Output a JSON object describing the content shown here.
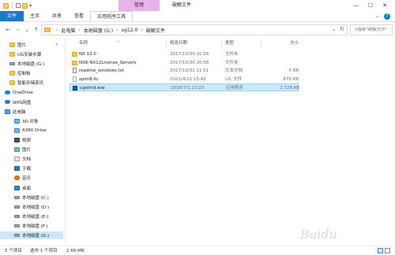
{
  "titlebar": {
    "manage_tab": "管理",
    "window_title": "破解文件",
    "controls": [
      "—",
      "☐",
      "✕"
    ]
  },
  "ribbon": {
    "tabs": [
      "文件",
      "主页",
      "共享",
      "查看",
      "应用程序工具"
    ]
  },
  "address": {
    "crumbs": [
      "此电脑",
      "本地磁盘 (G:)",
      "ug12.0",
      "破解文件"
    ],
    "search_placeholder": "搜索\"破解文件\""
  },
  "nav": {
    "items": [
      {
        "label": "图片",
        "icon": "folder",
        "pinned": true
      },
      {
        "label": "UG安装步骤",
        "icon": "folder"
      },
      {
        "label": "本地磁盘 (G:)",
        "icon": "drive"
      },
      {
        "label": "控制板",
        "icon": "folder"
      },
      {
        "label": "智能存储资讯",
        "icon": "folder"
      },
      {
        "label": "OneDrive",
        "icon": "cloud"
      },
      {
        "label": "WPS网盘",
        "icon": "wps"
      },
      {
        "label": "此电脑",
        "icon": "pc"
      },
      {
        "label": "3D 对象",
        "icon": "obj"
      },
      {
        "label": "A360 Drive",
        "icon": "obj"
      },
      {
        "label": "视频",
        "icon": "vid"
      },
      {
        "label": "图片",
        "icon": "img"
      },
      {
        "label": "文档",
        "icon": "doc"
      },
      {
        "label": "下载",
        "icon": "dl"
      },
      {
        "label": "音乐",
        "icon": "music"
      },
      {
        "label": "桌面",
        "icon": "desk"
      },
      {
        "label": "本地磁盘 (C:)",
        "icon": "drive"
      },
      {
        "label": "本地磁盘 (D:)",
        "icon": "drive"
      },
      {
        "label": "本地磁盘 (E:)",
        "icon": "drive"
      },
      {
        "label": "本地磁盘 (F:)",
        "icon": "drive"
      },
      {
        "label": "本地磁盘 (G:)",
        "icon": "drive",
        "selected": true
      }
    ]
  },
  "columns": {
    "name": "名称",
    "date": "修改日期",
    "type": "类型",
    "size": "大小"
  },
  "files": [
    {
      "name": "NX 12.0",
      "date": "2017/10/30 20:58",
      "type": "文件夹",
      "size": "",
      "icon": "folder"
    },
    {
      "name": "NX6-NX12License_Servers",
      "date": "2017/10/30 20:58",
      "type": "文件夹",
      "size": "",
      "icon": "folder"
    },
    {
      "name": "readme_windows.txt",
      "date": "2017/10/31 21:51",
      "type": "文本文档",
      "size": "5 KB",
      "icon": "txt"
    },
    {
      "name": "splm8.lic",
      "date": "2021/4/11 15:42",
      "type": "LIC 文件",
      "size": "879 KB",
      "icon": "lic"
    },
    {
      "name": "ugslmd.exe",
      "date": "2016/7/1 22:23",
      "type": "应用程序",
      "size": "2,728 KB",
      "icon": "exe",
      "selected": true
    }
  ],
  "status": {
    "count": "5 个项目",
    "selected": "选中 1 个项目",
    "size": "2.66 MB"
  },
  "watermark": "Baidu"
}
